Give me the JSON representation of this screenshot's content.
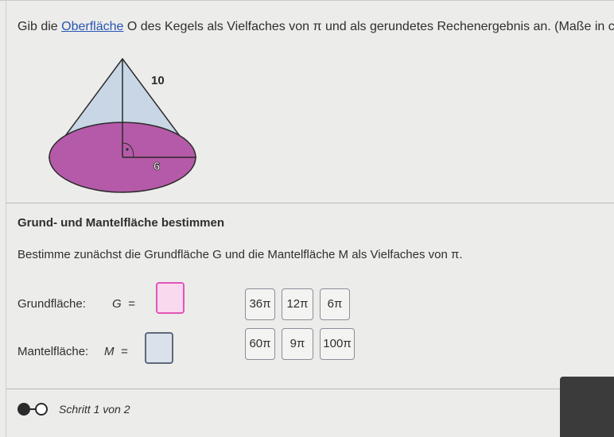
{
  "task": {
    "prefix": "Gib die ",
    "link": "Oberfläche",
    "suffix": " O des Kegels als Vielfaches von π und als gerundetes Rechenergebnis an. (Maße in cm)"
  },
  "figure": {
    "slant_label": "10",
    "radius_label": "6",
    "colors": {
      "side": "#c8d6e6",
      "base": "#b55aa8",
      "outline": "#2b2b2b"
    }
  },
  "section_title": "Grund- und Mantelfläche bestimmen",
  "instruction": "Bestimme zunächst die Grundfläche G und die Mantelfläche M als Vielfaches von π.",
  "rows": {
    "g": {
      "label": "Grundfläche:",
      "var": "G  ="
    },
    "m": {
      "label": "Mantelfläche:",
      "var": "M  ="
    }
  },
  "chips": {
    "row1": [
      "36π",
      "12π",
      "6π"
    ],
    "row2": [
      "60π",
      "9π",
      "100π"
    ]
  },
  "step": {
    "text": "Schritt 1 von 2"
  }
}
